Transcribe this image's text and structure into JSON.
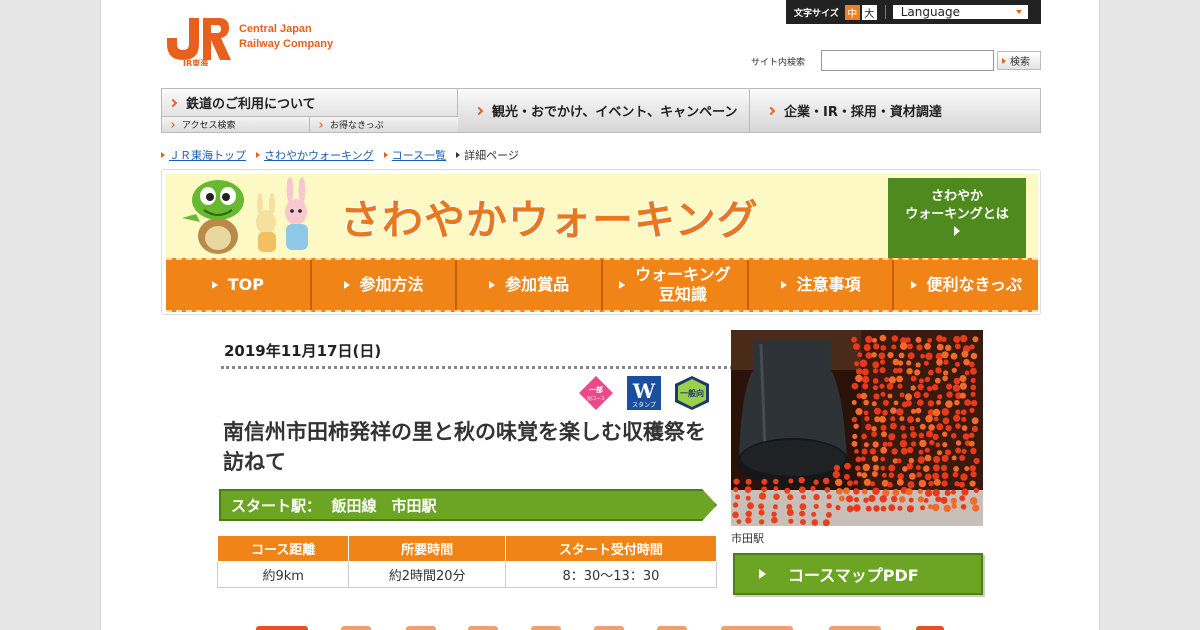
{
  "logo": {
    "mark": "JR",
    "sub": "JR東海",
    "line1": "Central Japan",
    "line2": "Railway Company"
  },
  "utility": {
    "font_size_label": "文字サイズ",
    "size_medium": "中",
    "size_large": "大",
    "language": "Language"
  },
  "search": {
    "label": "サイト内検索",
    "button": "検索",
    "value": ""
  },
  "global_nav": {
    "railway": "鉄道のご利用について",
    "access": "アクセス検索",
    "tickets": "お得なきっぷ",
    "tourism": "観光・おでかけ、イベント、キャンペーン",
    "corporate": "企業・IR・採用・資材調達"
  },
  "breadcrumb": [
    "ＪＲ東海トップ",
    "さわやかウォーキング",
    "コース一覧",
    "詳細ページ"
  ],
  "banner": {
    "title": "さわやかウォーキング",
    "about_line1": "さわやか",
    "about_line2": "ウォーキングとは",
    "menu": [
      "TOP",
      "参加方法",
      "参加賞品",
      "ウォーキング",
      "豆知識",
      "注意事項",
      "便利なきっぷ"
    ]
  },
  "event": {
    "date": "2019年11月17日(日)",
    "badges": {
      "partial": "一部",
      "partial_sub": "別コース",
      "stamp": "W",
      "stamp_sub": "スタンプ",
      "general": "一般向"
    },
    "title": "南信州市田柿発祥の里と秋の味覚を楽しむ収穫祭を訪ねて",
    "start_label": "スタート駅：",
    "start_station": "飯田線　市田駅",
    "table_headers": [
      "コース距離",
      "所要時間",
      "スタート受付時間"
    ],
    "table_values": [
      "約9km",
      "約2時間20分",
      "8：30～13：30"
    ],
    "photo_caption": "市田駅",
    "pdf_button": "コースマップPDF"
  },
  "colors": {
    "accent": "#e8601e",
    "nav_orange": "#f08416",
    "green": "#6ca424",
    "banner_bg": "#fdf9c4"
  }
}
